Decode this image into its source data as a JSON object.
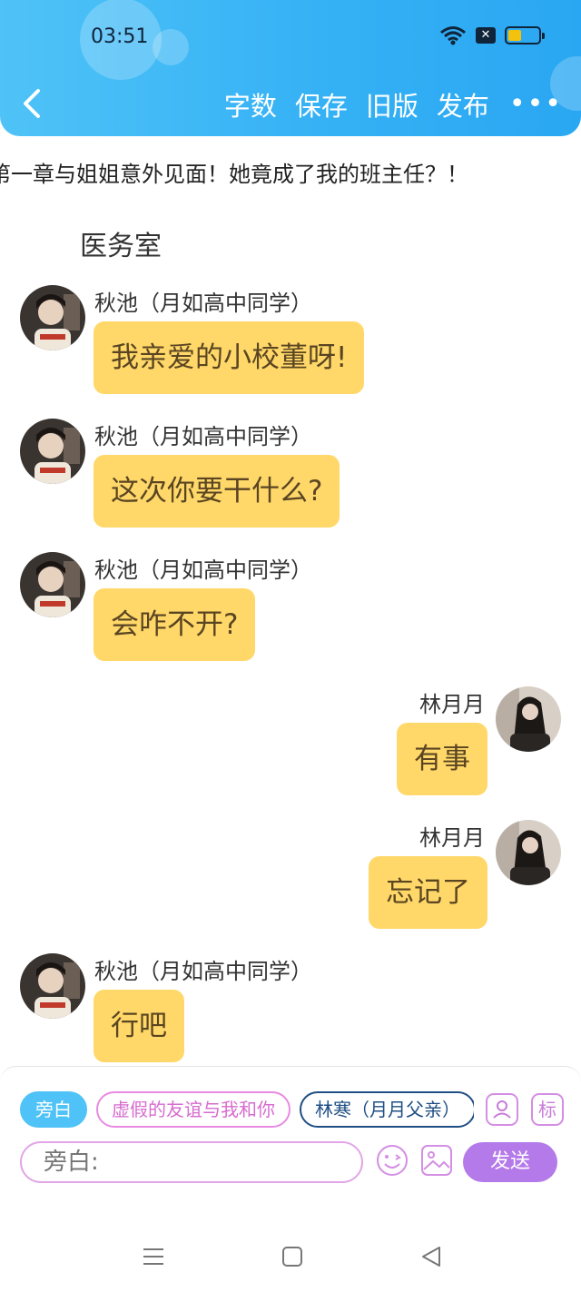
{
  "status_bar": {
    "time": "03:51",
    "battery_level": 0.45
  },
  "toolbar": {
    "back_icon": "chevron-left-icon",
    "actions": [
      "字数",
      "保存",
      "旧版",
      "发布"
    ],
    "more_label": "•••",
    "accent_color": "#35b1f5"
  },
  "chapter": {
    "title": "第一章与姐姐意外见面！她竟成了我的班主任？！"
  },
  "scene": {
    "location": "医务室"
  },
  "messages": [
    {
      "sender": "秋池（月如高中同学）",
      "text": "我亲爱的小校董呀!",
      "side": "left"
    },
    {
      "sender": "秋池（月如高中同学）",
      "text": "这次你要干什么?",
      "side": "left"
    },
    {
      "sender": "秋池（月如高中同学）",
      "text": "会咋不开?",
      "side": "left"
    },
    {
      "sender": "林月月",
      "text": "有事",
      "side": "right"
    },
    {
      "sender": "林月月",
      "text": "忘记了",
      "side": "right"
    },
    {
      "sender": "秋池（月如高中同学）",
      "text": "行吧",
      "side": "left"
    }
  ],
  "bubble_color": "#ffd869",
  "composer": {
    "roles": [
      {
        "label": "旁白",
        "style": "active"
      },
      {
        "label": "虚假的友谊与我和你",
        "style": "pink"
      },
      {
        "label": "林寒（月月父亲）",
        "style": "navy"
      }
    ],
    "character_icon": "person-card-icon",
    "tag_label": "标",
    "placeholder": "旁白:",
    "emoji_icon": "smiley-icon",
    "image_icon": "image-icon",
    "send_label": "发送",
    "send_color": "#b47ae9"
  },
  "system_nav": {
    "icons": [
      "menu-icon",
      "home-icon",
      "back-icon"
    ]
  }
}
